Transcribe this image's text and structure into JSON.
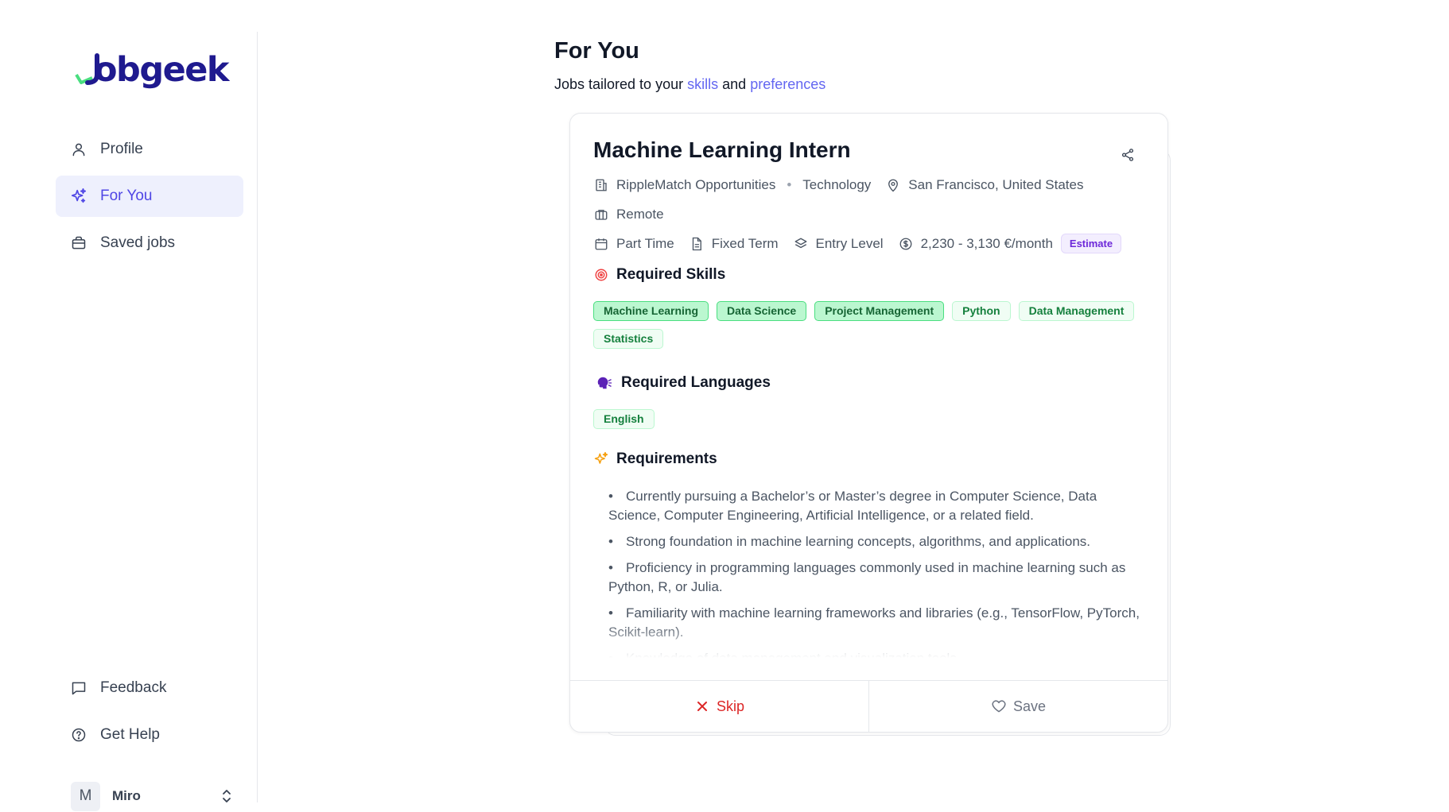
{
  "brand": {
    "name": "Jobgeek",
    "logo_text": "obgeek",
    "colors": {
      "primary": "#1f1a8f",
      "accent": "#4ade80"
    }
  },
  "sidebar": {
    "nav": [
      {
        "label": "Profile",
        "icon": "user-icon",
        "active": false
      },
      {
        "label": "For You",
        "icon": "sparkles-icon",
        "active": true
      },
      {
        "label": "Saved jobs",
        "icon": "briefcase-icon",
        "active": false
      }
    ],
    "bottom_nav": [
      {
        "label": "Feedback",
        "icon": "message-icon"
      },
      {
        "label": "Get Help",
        "icon": "help-circle-icon"
      }
    ],
    "user": {
      "initial": "M",
      "name": "Miro"
    }
  },
  "header": {
    "title": "For You",
    "subtitle_prefix": "Jobs tailored to your",
    "subtitle_link1": "skills",
    "subtitle_and": "and",
    "subtitle_link2": "preferences"
  },
  "job": {
    "title": "Machine Learning Intern",
    "company": "RippleMatch Opportunities",
    "industry": "Technology",
    "location": "San Francisco, United States",
    "work_mode": "Remote",
    "schedule": "Part Time",
    "contract": "Fixed Term",
    "level": "Entry Level",
    "salary": "2,230 - 3,130 €/month",
    "salary_badge": "Estimate",
    "skills_heading": "Required Skills",
    "skills": [
      {
        "label": "Machine Learning",
        "matched": true
      },
      {
        "label": "Data Science",
        "matched": true
      },
      {
        "label": "Project Management",
        "matched": true
      },
      {
        "label": "Python",
        "matched": false
      },
      {
        "label": "Data Management",
        "matched": false
      },
      {
        "label": "Statistics",
        "matched": false
      }
    ],
    "languages_heading": "Required Languages",
    "languages": [
      "English"
    ],
    "requirements_heading": "Requirements",
    "requirements": [
      "Currently pursuing a Bachelor’s or Master’s degree in Computer Science, Data Science, Computer Engineering, Artificial Intelligence, or a related field.",
      "Strong foundation in machine learning concepts, algorithms, and applications.",
      "Proficiency in programming languages commonly used in machine learning such as Python, R, or Julia.",
      "Familiarity with machine learning frameworks and libraries (e.g., TensorFlow, PyTorch, Scikit-learn).",
      "Knowledge of data management and visualization tools"
    ]
  },
  "actions": {
    "skip_label": "Skip",
    "save_label": "Save"
  }
}
